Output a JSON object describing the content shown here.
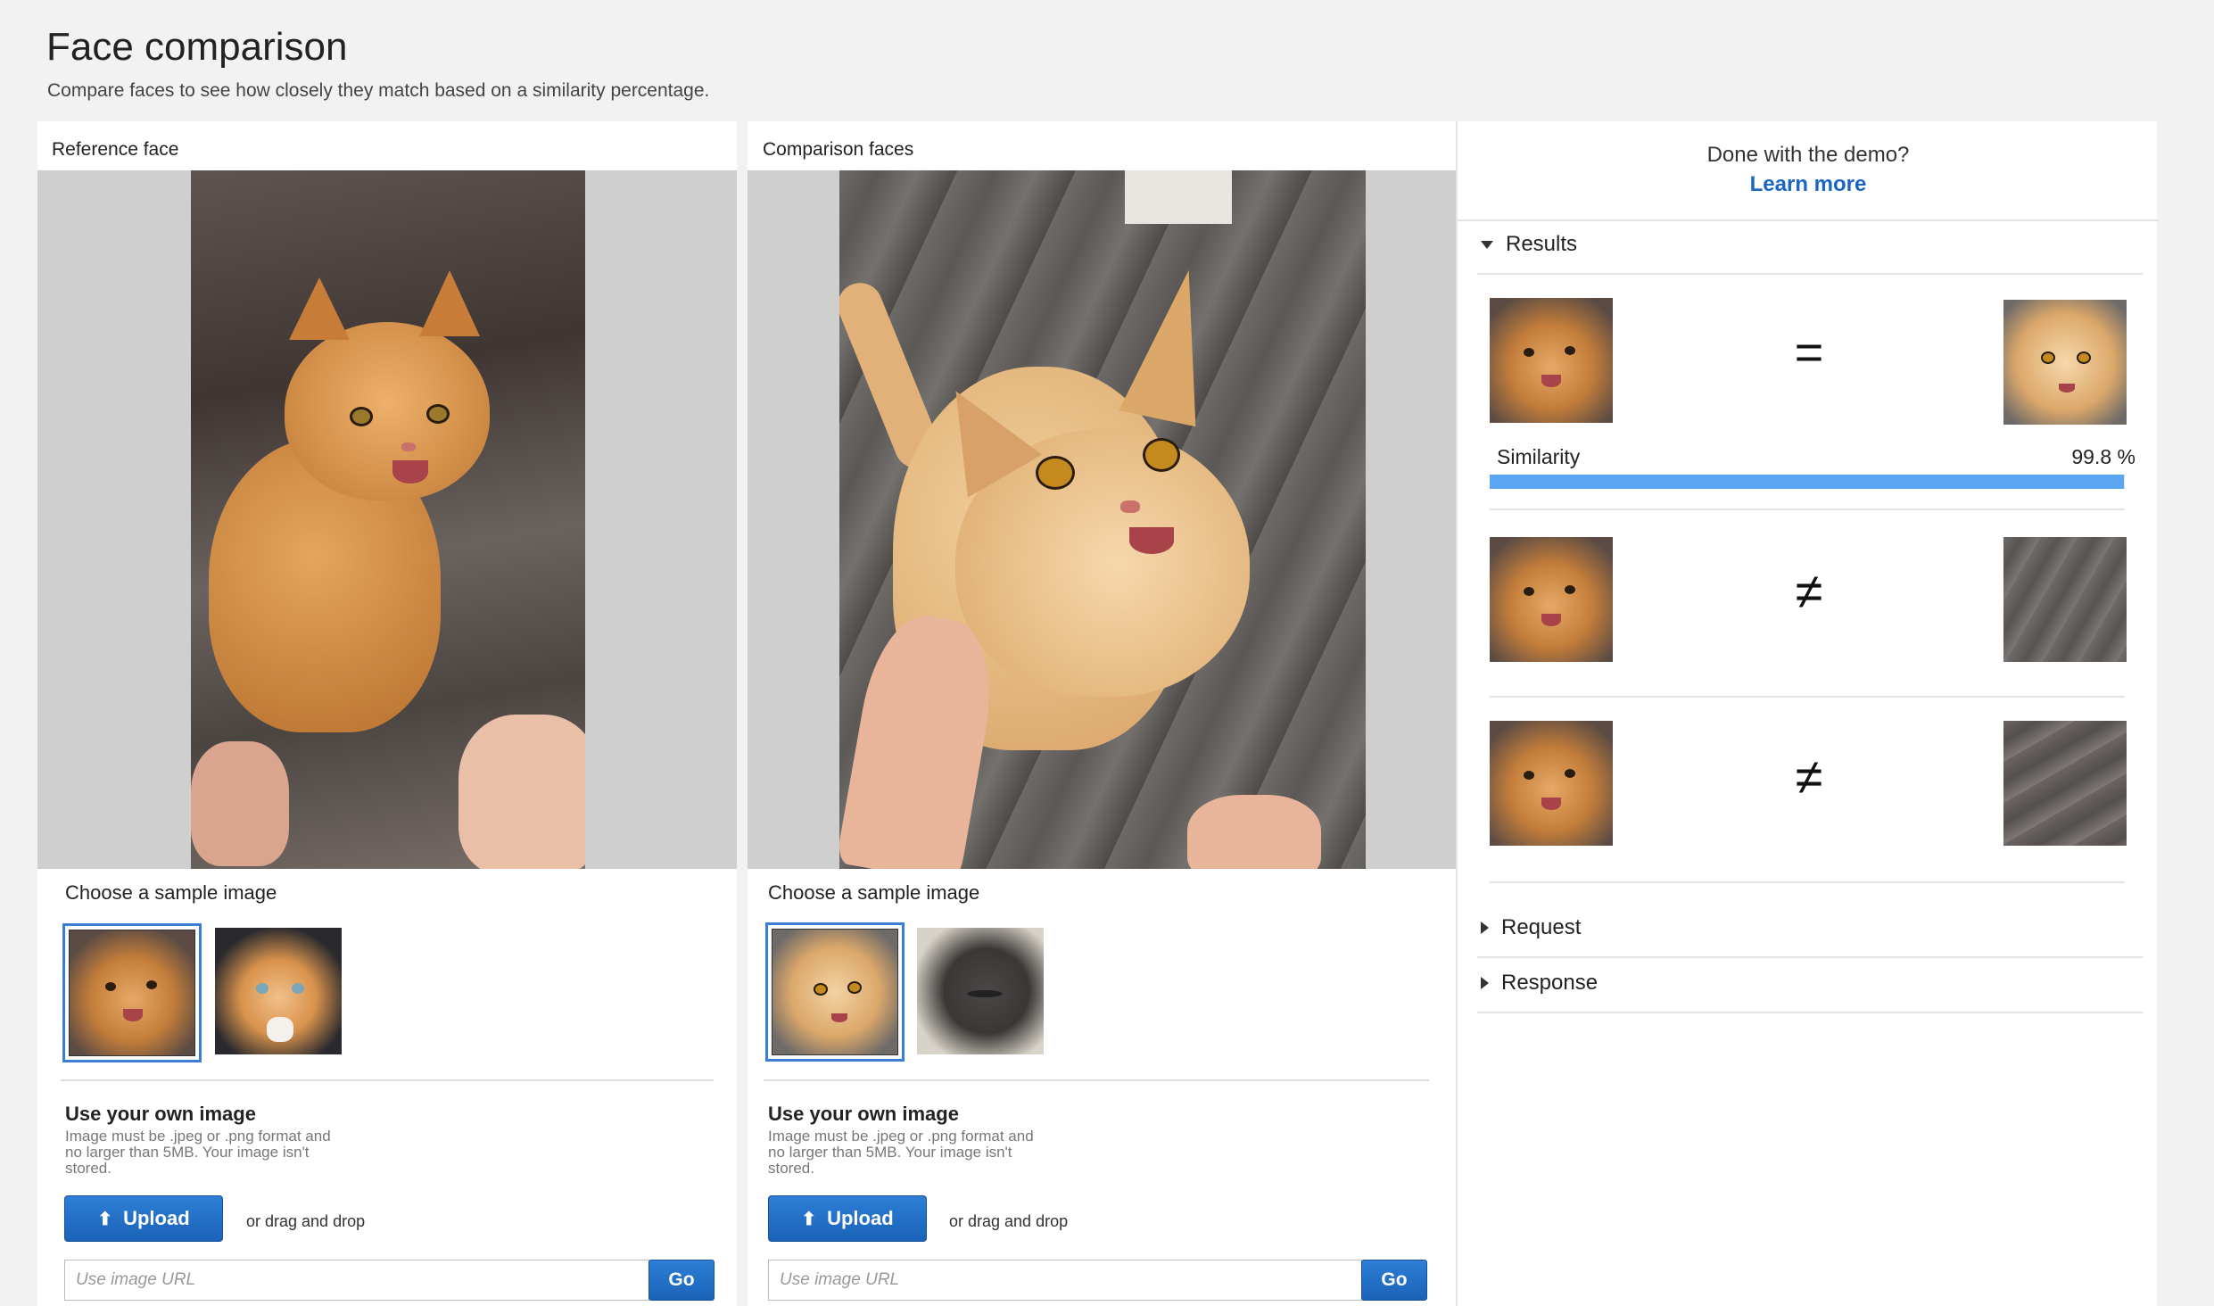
{
  "header": {
    "title": "Face comparison",
    "subtitle": "Compare faces to see how closely they match based on a similarity percentage."
  },
  "reference": {
    "label": "Reference face",
    "choose_label": "Choose a sample image",
    "own_title": "Use your own image",
    "own_note": "Image must be .jpeg or .png format and no larger than 5MB. Your image isn't stored.",
    "upload_label": "Upload",
    "drag_text": "or drag and drop",
    "url_placeholder": "Use image URL",
    "go_label": "Go"
  },
  "comparison": {
    "label": "Comparison faces",
    "choose_label": "Choose a sample image",
    "own_title": "Use your own image",
    "own_note": "Image must be .jpeg or .png format and no larger than 5MB. Your image isn't stored.",
    "upload_label": "Upload",
    "drag_text": "or drag and drop",
    "url_placeholder": "Use image URL",
    "go_label": "Go"
  },
  "results_panel": {
    "done_text": "Done with the demo?",
    "learn_more": "Learn more",
    "results_label": "Results",
    "request_label": "Request",
    "response_label": "Response",
    "rows": [
      {
        "symbol": "=",
        "similarity_label": "Similarity",
        "similarity_value": "99.8 %",
        "similarity_fraction": 0.998
      },
      {
        "symbol": "≠"
      },
      {
        "symbol": "≠"
      }
    ]
  },
  "colors": {
    "accent": "#1a66c2",
    "button": "#1f6cc4",
    "similarity_bar": "#5aa6f2"
  }
}
